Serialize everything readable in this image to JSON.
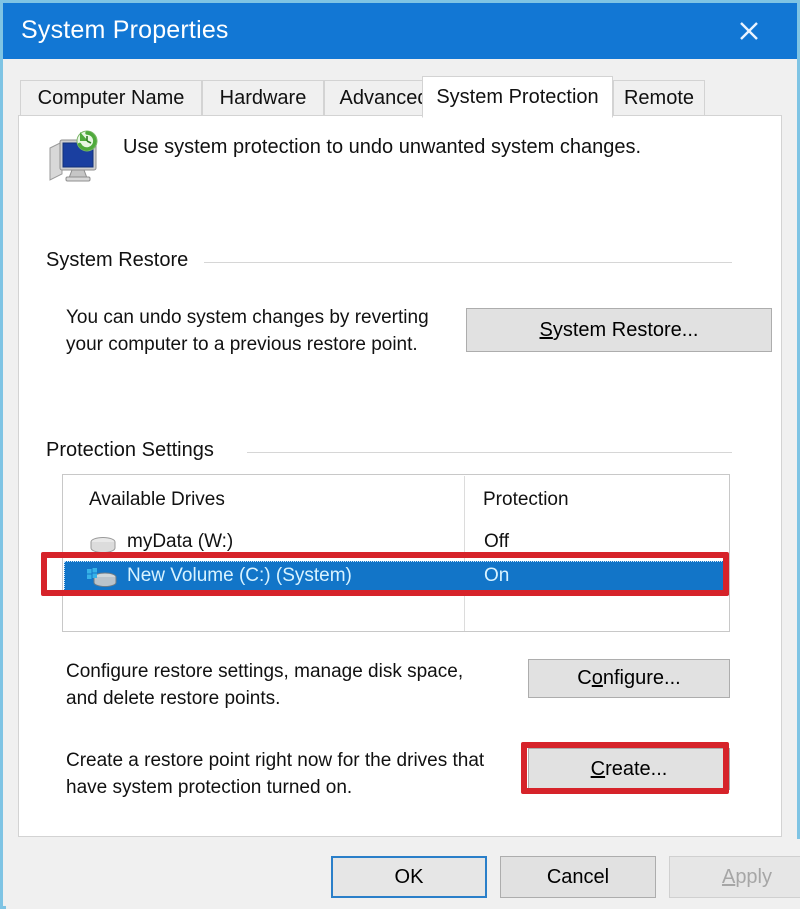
{
  "window": {
    "title": "System Properties",
    "close_icon": "close-icon",
    "accent_color": "#1277d4",
    "selection_color": "#1275c8",
    "annotation_color": "#d6232a"
  },
  "tabs": [
    {
      "label": "Computer Name",
      "active": false
    },
    {
      "label": "Hardware",
      "active": false
    },
    {
      "label": "Advanced",
      "active": false
    },
    {
      "label": "System Protection",
      "active": true
    },
    {
      "label": "Remote",
      "active": false
    }
  ],
  "header": {
    "icon": "system-protection-icon",
    "text": "Use system protection to undo unwanted system changes."
  },
  "system_restore": {
    "group_label": "System Restore",
    "description_line1": "You can undo system changes by reverting",
    "description_line2": "your computer to a previous restore point.",
    "button_label": "System Restore...",
    "button_accesskey": "S"
  },
  "protection_settings": {
    "group_label": "Protection Settings",
    "columns": [
      "Available Drives",
      "Protection"
    ],
    "drives": [
      {
        "name": "myData (W:)",
        "protection": "Off",
        "selected": false,
        "icon": "drive-icon"
      },
      {
        "name": "New Volume (C:) (System)",
        "protection": "On",
        "selected": true,
        "icon": "system-drive-icon"
      }
    ],
    "configure_text_line1": "Configure restore settings, manage disk space,",
    "configure_text_line2": "and delete restore points.",
    "configure_button_label": "Configure...",
    "configure_button_accesskey": "o",
    "create_text_line1": "Create a restore point right now for the drives that",
    "create_text_line2": "have system protection turned on.",
    "create_button_label": "Create...",
    "create_button_accesskey": "C"
  },
  "footer": {
    "ok_label": "OK",
    "cancel_label": "Cancel",
    "apply_label": "Apply",
    "apply_accesskey": "A",
    "apply_disabled": true
  }
}
